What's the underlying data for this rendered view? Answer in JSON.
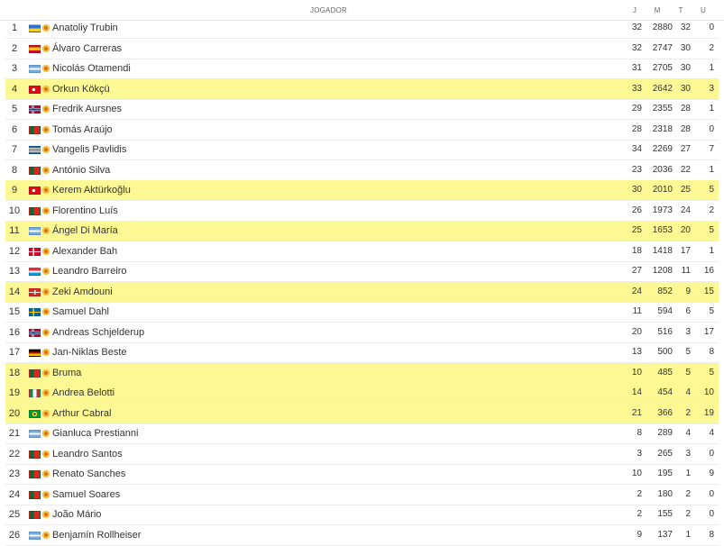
{
  "header": {
    "player": "JOGADOR",
    "j": "J",
    "m": "M",
    "t": "T",
    "u": "U"
  },
  "rows": [
    {
      "pos": "1",
      "name": "Anatoliy Trubin",
      "flag": "ukraine",
      "j": "32",
      "m": "2880",
      "t": "32",
      "u": "0",
      "hl": false
    },
    {
      "pos": "2",
      "name": "Álvaro Carreras",
      "flag": "spain",
      "j": "32",
      "m": "2747",
      "t": "30",
      "u": "2",
      "hl": false
    },
    {
      "pos": "3",
      "name": "Nicolás Otamendi",
      "flag": "argentina",
      "j": "31",
      "m": "2705",
      "t": "30",
      "u": "1",
      "hl": false
    },
    {
      "pos": "4",
      "name": "Orkun Kökçü",
      "flag": "turkey",
      "j": "33",
      "m": "2642",
      "t": "30",
      "u": "3",
      "hl": true
    },
    {
      "pos": "5",
      "name": "Fredrik Aursnes",
      "flag": "norway",
      "j": "29",
      "m": "2355",
      "t": "28",
      "u": "1",
      "hl": false
    },
    {
      "pos": "6",
      "name": "Tomás Araújo",
      "flag": "portugal",
      "j": "28",
      "m": "2318",
      "t": "28",
      "u": "0",
      "hl": false
    },
    {
      "pos": "7",
      "name": "Vangelis Pavlidis",
      "flag": "greece",
      "j": "34",
      "m": "2269",
      "t": "27",
      "u": "7",
      "hl": false
    },
    {
      "pos": "8",
      "name": "António Silva",
      "flag": "portugal",
      "j": "23",
      "m": "2036",
      "t": "22",
      "u": "1",
      "hl": false
    },
    {
      "pos": "9",
      "name": "Kerem Aktürkoğlu",
      "flag": "turkey",
      "j": "30",
      "m": "2010",
      "t": "25",
      "u": "5",
      "hl": true
    },
    {
      "pos": "10",
      "name": "Florentino Luís",
      "flag": "portugal",
      "j": "26",
      "m": "1973",
      "t": "24",
      "u": "2",
      "hl": false
    },
    {
      "pos": "11",
      "name": "Ángel Di María",
      "flag": "argentina",
      "j": "25",
      "m": "1653",
      "t": "20",
      "u": "5",
      "hl": true
    },
    {
      "pos": "12",
      "name": "Alexander Bah",
      "flag": "denmark",
      "j": "18",
      "m": "1418",
      "t": "17",
      "u": "1",
      "hl": false
    },
    {
      "pos": "13",
      "name": "Leandro Barreiro",
      "flag": "luxembourg",
      "j": "27",
      "m": "1208",
      "t": "11",
      "u": "16",
      "hl": false
    },
    {
      "pos": "14",
      "name": "Zeki Amdouni",
      "flag": "switzerland",
      "j": "24",
      "m": "852",
      "t": "9",
      "u": "15",
      "hl": true
    },
    {
      "pos": "15",
      "name": "Samuel Dahl",
      "flag": "sweden",
      "j": "11",
      "m": "594",
      "t": "6",
      "u": "5",
      "hl": false
    },
    {
      "pos": "16",
      "name": "Andreas Schjelderup",
      "flag": "norway",
      "j": "20",
      "m": "516",
      "t": "3",
      "u": "17",
      "hl": false
    },
    {
      "pos": "17",
      "name": "Jan-Niklas Beste",
      "flag": "germany",
      "j": "13",
      "m": "500",
      "t": "5",
      "u": "8",
      "hl": false
    },
    {
      "pos": "18",
      "name": "Bruma",
      "flag": "portugal",
      "j": "10",
      "m": "485",
      "t": "5",
      "u": "5",
      "hl": true
    },
    {
      "pos": "19",
      "name": "Andrea Belotti",
      "flag": "italy",
      "j": "14",
      "m": "454",
      "t": "4",
      "u": "10",
      "hl": true
    },
    {
      "pos": "20",
      "name": "Arthur Cabral",
      "flag": "brazil",
      "j": "21",
      "m": "366",
      "t": "2",
      "u": "19",
      "hl": true
    },
    {
      "pos": "21",
      "name": "Gianluca Prestianni",
      "flag": "argentina",
      "j": "8",
      "m": "289",
      "t": "4",
      "u": "4",
      "hl": false
    },
    {
      "pos": "22",
      "name": "Leandro Santos",
      "flag": "portugal",
      "j": "3",
      "m": "265",
      "t": "3",
      "u": "0",
      "hl": false
    },
    {
      "pos": "23",
      "name": "Renato Sanches",
      "flag": "portugal",
      "j": "10",
      "m": "195",
      "t": "1",
      "u": "9",
      "hl": false
    },
    {
      "pos": "24",
      "name": "Samuel Soares",
      "flag": "portugal",
      "j": "2",
      "m": "180",
      "t": "2",
      "u": "0",
      "hl": false
    },
    {
      "pos": "25",
      "name": "João Mário",
      "flag": "portugal",
      "j": "2",
      "m": "155",
      "t": "2",
      "u": "0",
      "hl": false
    },
    {
      "pos": "26",
      "name": "Benjamín Rollheiser",
      "flag": "argentina",
      "j": "9",
      "m": "137",
      "t": "1",
      "u": "8",
      "hl": false
    }
  ],
  "colors": {
    "highlight": "#fcf994",
    "divider": "#ececec"
  }
}
